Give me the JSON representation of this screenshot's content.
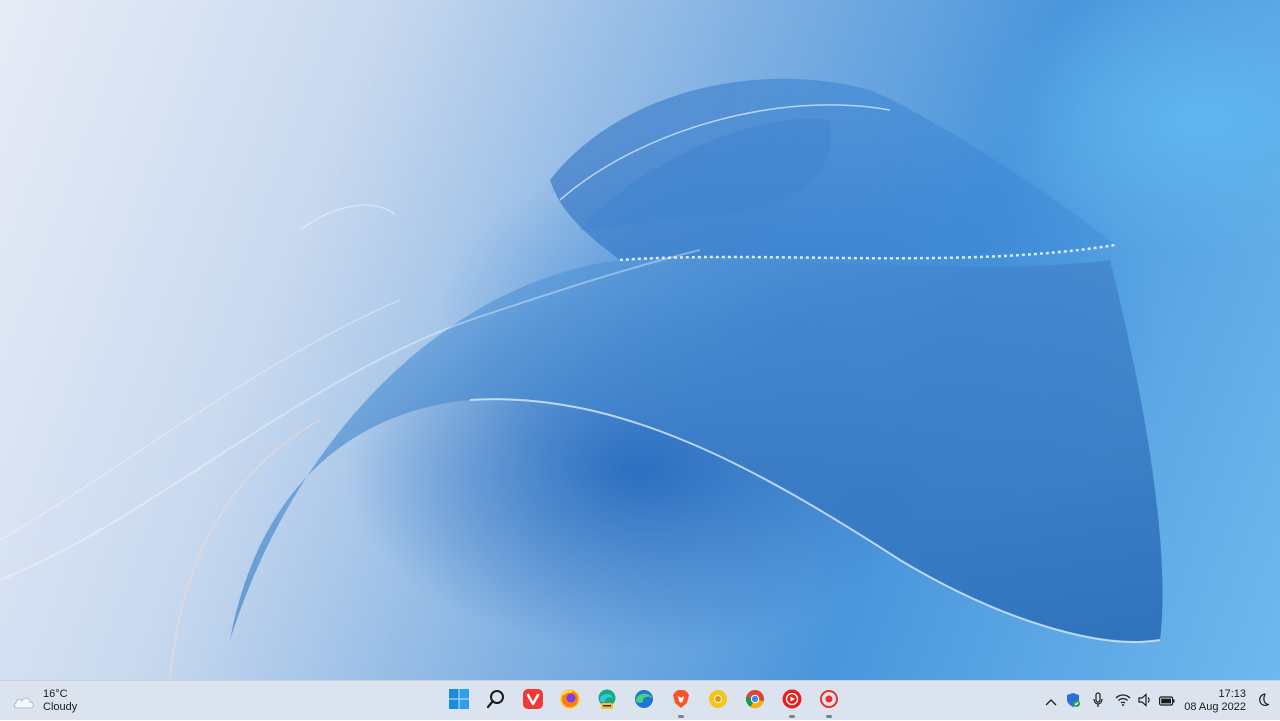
{
  "desktop": {
    "wallpaper": "Windows 11 bloom wallpaper",
    "colors": {
      "deep_blue": "#2c6fc0",
      "light_blue": "#6fb9ee",
      "mist": "#e7ecf6"
    }
  },
  "taskbar": {
    "background": "#dbe4ee",
    "weather": {
      "temperature": "16°C",
      "condition": "Cloudy",
      "icon": "cloud-icon"
    },
    "pinned": [
      {
        "name": "start-button",
        "icon": "windows-logo-icon",
        "running": false
      },
      {
        "name": "search-button",
        "icon": "search-icon",
        "running": false
      },
      {
        "name": "vivaldi-app",
        "icon": "vivaldi-icon",
        "running": false
      },
      {
        "name": "firefox-app",
        "icon": "firefox-icon",
        "running": false
      },
      {
        "name": "edge-canary-app",
        "icon": "edge-canary-icon",
        "running": false
      },
      {
        "name": "edge-app",
        "icon": "edge-icon",
        "running": false
      },
      {
        "name": "brave-app",
        "icon": "brave-icon",
        "running": true
      },
      {
        "name": "chrome-canary-app",
        "icon": "chrome-canary-icon",
        "running": false
      },
      {
        "name": "chrome-app",
        "icon": "chrome-icon",
        "running": false
      },
      {
        "name": "youtube-music-app",
        "icon": "youtube-music-icon",
        "running": true
      },
      {
        "name": "screen-recorder-app",
        "icon": "record-icon",
        "running": true
      }
    ],
    "tray": {
      "icons": [
        "chevron-up-icon",
        "security-shield-icon",
        "microphone-icon",
        "wifi-icon",
        "volume-icon",
        "battery-icon"
      ]
    },
    "clock": {
      "time": "17:13",
      "date": "08 Aug 2022"
    },
    "notification_icon": "do-not-disturb-moon-icon"
  }
}
